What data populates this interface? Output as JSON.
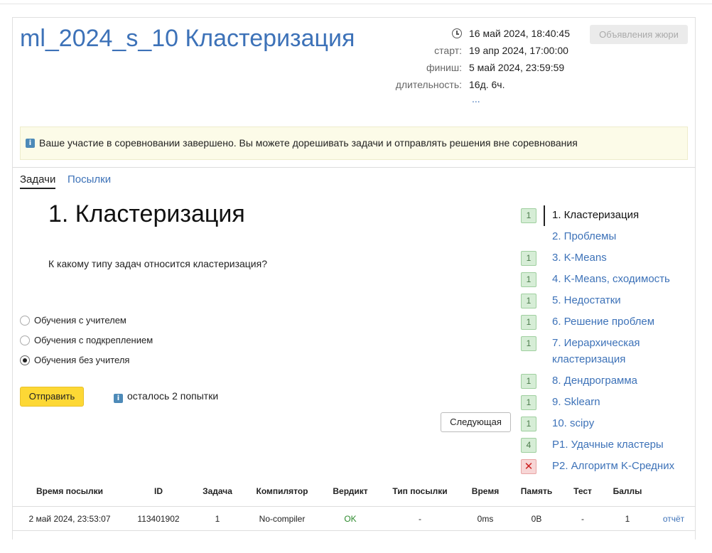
{
  "contest": {
    "title": "ml_2024_s_10 Кластеризация",
    "current_time": "16 май 2024, 18:40:45",
    "start_label": "старт:",
    "start": "19 апр 2024, 17:00:00",
    "finish_label": "финиш:",
    "finish": "5 май 2024, 23:59:59",
    "duration_label": "длительность:",
    "duration": "16д. 6ч.",
    "more": "...",
    "jury_button": "Объявления жюри"
  },
  "notice": {
    "icon": "info-icon",
    "text": "Ваше участие в соревновании завершено. Вы можете дорешивать задачи и отправлять решения вне соревнования"
  },
  "tabs": [
    {
      "label": "Задачи",
      "active": true
    },
    {
      "label": "Посылки",
      "active": false
    }
  ],
  "problem": {
    "title": "1. Кластеризация",
    "question": "К какому типу задач относится кластеризация?",
    "options": [
      {
        "label": "Обучения с учителем",
        "checked": false
      },
      {
        "label": "Обучения с подкреплением",
        "checked": false
      },
      {
        "label": "Обучения без учителя",
        "checked": true
      }
    ],
    "submit_label": "Отправить",
    "attempts_text": "осталось 2 попытки",
    "next_label": "Следующая"
  },
  "sidebar": [
    {
      "badge": "1",
      "status": "ok",
      "label": "1. Кластеризация",
      "active": true
    },
    {
      "badge": "",
      "status": "none",
      "label": "2. Проблемы",
      "active": false
    },
    {
      "badge": "1",
      "status": "ok",
      "label": "3. K-Means",
      "active": false
    },
    {
      "badge": "1",
      "status": "ok",
      "label": "4. K-Means, сходимость",
      "active": false
    },
    {
      "badge": "1",
      "status": "ok",
      "label": "5. Недостатки",
      "active": false
    },
    {
      "badge": "1",
      "status": "ok",
      "label": "6. Решение проблем",
      "active": false
    },
    {
      "badge": "1",
      "status": "ok",
      "label": "7. Иерархическая",
      "label2": "кластеризация",
      "active": false
    },
    {
      "badge": "1",
      "status": "ok",
      "label": "8. Дендрограмма",
      "active": false
    },
    {
      "badge": "1",
      "status": "ok",
      "label": "9. Sklearn",
      "active": false
    },
    {
      "badge": "1",
      "status": "ok",
      "label": "10. scipy",
      "active": false
    },
    {
      "badge": "4",
      "status": "ok",
      "label": "P1. Удачные кластеры",
      "active": false
    },
    {
      "badge": "✕",
      "status": "fail",
      "label": "P2. Алгоритм K-Средних",
      "active": false
    }
  ],
  "submissions": {
    "headers": [
      "Время посылки",
      "ID",
      "Задача",
      "Компилятор",
      "Вердикт",
      "Тип посылки",
      "Время",
      "Память",
      "Тест",
      "Баллы"
    ],
    "rows": [
      {
        "time": "2 май 2024, 23:53:07",
        "id": "113401902",
        "task": "1",
        "compiler": "No-compiler",
        "verdict": "OK",
        "type": "-",
        "run_time": "0ms",
        "memory": "0B",
        "test": "-",
        "score": "1",
        "report": "отчёт"
      }
    ]
  }
}
